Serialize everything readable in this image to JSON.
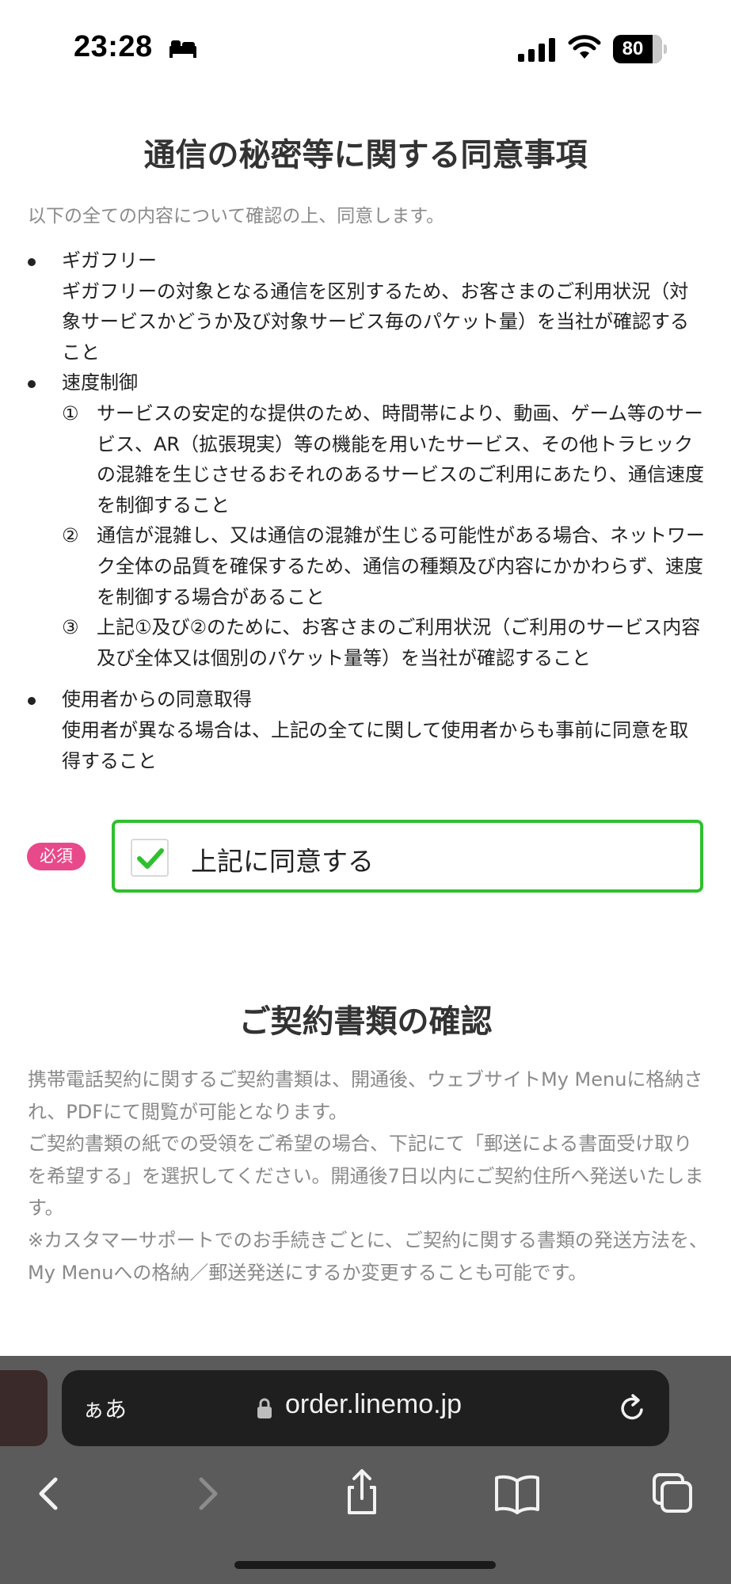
{
  "status_bar": {
    "time": "23:28",
    "battery": "80",
    "battery_level": 0.8,
    "icons": [
      "sleep-icon",
      "signal-icon",
      "wifi-icon",
      "battery-icon"
    ]
  },
  "consent_section": {
    "title": "通信の秘密等に関する同意事項",
    "intro": "以下の全ての内容について確認の上、同意します。",
    "items": [
      {
        "title": "ギガフリー",
        "body": "ギガフリーの対象となる通信を区別するため、お客さまのご利用状況（対象サービスかどうか及び対象サービス毎のパケット量）を当社が確認すること"
      },
      {
        "title": "速度制御",
        "subitems": [
          {
            "num": "①",
            "text": "サービスの安定的な提供のため、時間帯により、動画、ゲーム等のサービス、AR（拡張現実）等の機能を用いたサービス、その他トラヒックの混雑を生じさせるおそれのあるサービスのご利用にあたり、通信速度を制御すること"
          },
          {
            "num": "②",
            "text": "通信が混雑し、又は通信の混雑が生じる可能性がある場合、ネットワーク全体の品質を確保するため、通信の種類及び内容にかかわらず、速度を制御する場合があること"
          },
          {
            "num": "③",
            "text": "上記①及び②のために、お客さまのご利用状況（ご利用のサービス内容及び全体又は個別のパケット量等）を当社が確認すること"
          }
        ]
      },
      {
        "title": "使用者からの同意取得",
        "body": "使用者が異なる場合は、上記の全てに関して使用者からも事前に同意を取得すること"
      }
    ],
    "required_badge": "必須",
    "agree_label": "上記に同意する",
    "agree_checked": true,
    "accent_color": "#2ec02e",
    "badge_color": "#e8498a"
  },
  "documents_section": {
    "title": "ご契約書類の確認",
    "paragraphs": [
      "携帯電話契約に関するご契約書類は、開通後、ウェブサイトMy Menuに格納され、PDFにて閲覧が可能となります。",
      "ご契約書類の紙での受領をご希望の場合、下記にて「郵送による書面受け取りを希望する」を選択してください。開通後7日以内にご契約住所へ発送いたします。",
      "※カスタマーサポートでのお手続きごとに、ご契約に関する書類の発送方法を、My Menuへの格納／郵送発送にするか変更することも可能です。"
    ]
  },
  "browser": {
    "aa_label": "ぁあ",
    "url": "order.linemo.jp",
    "icons": [
      "lock-icon",
      "reload-icon",
      "back-icon",
      "forward-icon",
      "share-icon",
      "bookmarks-icon",
      "tabs-icon"
    ]
  }
}
